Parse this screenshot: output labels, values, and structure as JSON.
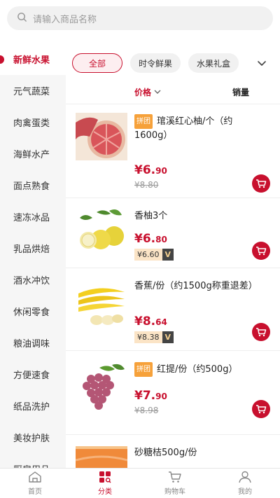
{
  "search": {
    "placeholder": "请输入商品名称"
  },
  "sidebar": {
    "items": [
      {
        "label": "新鲜水果",
        "active": true
      },
      {
        "label": "元气蔬菜"
      },
      {
        "label": "肉禽蛋类"
      },
      {
        "label": "海鲜水产"
      },
      {
        "label": "面点熟食"
      },
      {
        "label": "速冻冰品"
      },
      {
        "label": "乳品烘焙"
      },
      {
        "label": "酒水冲饮"
      },
      {
        "label": "休闲零食"
      },
      {
        "label": "粮油调味"
      },
      {
        "label": "方便速食"
      },
      {
        "label": "纸品洗护"
      },
      {
        "label": "美妆护肤"
      },
      {
        "label": "厨房用品"
      }
    ]
  },
  "filters": {
    "chips": [
      "全部",
      "时令鲜果",
      "水果礼盒"
    ]
  },
  "sort": {
    "sales_label": "销量",
    "price_label": "价格"
  },
  "products": [
    {
      "tag": "拼团",
      "title": "琯溪红心柚/个（约1600g）",
      "price_int": "¥6.",
      "price_dec": "90",
      "orig_price": "¥8.80",
      "image": "red-pomelo"
    },
    {
      "title": "香柚3个",
      "price_int": "¥6.",
      "price_dec": "80",
      "vip_price": "¥6.60",
      "vip_tag": "V",
      "image": "pomelos"
    },
    {
      "title": "香蕉/份（约1500g称重退差）",
      "price_int": "¥8.",
      "price_dec": "64",
      "vip_price": "¥8.38",
      "vip_tag": "V",
      "image": "bananas"
    },
    {
      "tag": "拼团",
      "title": "红提/份（约500g）",
      "price_int": "¥7.",
      "price_dec": "90",
      "orig_price": "¥8.98",
      "image": "red-grapes"
    },
    {
      "title": "砂糖桔500g/份",
      "image": "tangerines"
    }
  ],
  "tabbar": {
    "tabs": [
      {
        "label": "首页",
        "icon": "home-icon"
      },
      {
        "label": "分类",
        "icon": "category-icon",
        "active": true
      },
      {
        "label": "购物车",
        "icon": "cart-icon"
      },
      {
        "label": "我的",
        "icon": "user-icon"
      }
    ]
  },
  "colors": {
    "accent": "#c8102e",
    "tag": "#f6a13a"
  }
}
